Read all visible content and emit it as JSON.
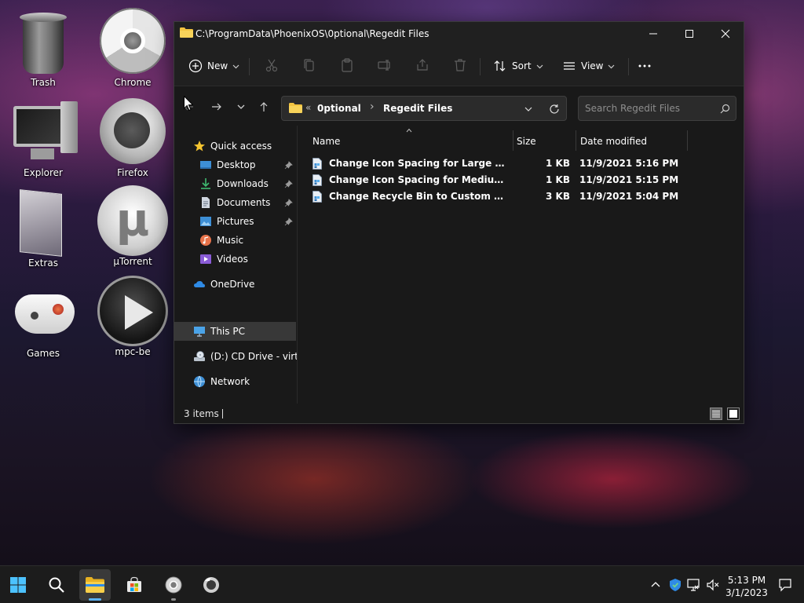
{
  "desktop": {
    "icons": [
      {
        "label": "Trash"
      },
      {
        "label": "Chrome"
      },
      {
        "label": "Explorer"
      },
      {
        "label": "Firefox"
      },
      {
        "label": "Extras"
      },
      {
        "label": "µTorrent"
      },
      {
        "label": "Games"
      },
      {
        "label": "mpc-be"
      }
    ]
  },
  "window": {
    "title": "C:\\ProgramData\\PhoenixOS\\0ptional\\Regedit Files",
    "commands": {
      "new_label": "New",
      "sort_label": "Sort",
      "view_label": "View"
    },
    "address": {
      "overflow": "«",
      "crumbs": [
        "0ptional",
        "Regedit Files"
      ],
      "separator": "›"
    },
    "search": {
      "placeholder": "Search Regedit Files"
    },
    "sidebar": {
      "items": [
        {
          "label": "Quick access",
          "icon": "star-icon"
        },
        {
          "label": "Desktop",
          "icon": "desktop-icon",
          "pinned": true
        },
        {
          "label": "Downloads",
          "icon": "download-icon",
          "pinned": true
        },
        {
          "label": "Documents",
          "icon": "document-icon",
          "pinned": true
        },
        {
          "label": "Pictures",
          "icon": "pictures-icon",
          "pinned": true
        },
        {
          "label": "Music",
          "icon": "music-icon"
        },
        {
          "label": "Videos",
          "icon": "videos-icon"
        },
        {
          "label": "OneDrive",
          "icon": "cloud-icon"
        },
        {
          "label": "This PC",
          "icon": "computer-icon",
          "selected": true
        },
        {
          "label": "(D:) CD Drive - virtio-win",
          "icon": "cd-drive-icon"
        },
        {
          "label": "Network",
          "icon": "network-icon"
        }
      ]
    },
    "columns": {
      "name": "Name",
      "size": "Size",
      "date": "Date modified"
    },
    "files": [
      {
        "name": "Change Icon Spacing for Large Desktop Icons.reg",
        "size": "1 KB",
        "date": "11/9/2021 5:16 PM"
      },
      {
        "name": "Change Icon Spacing for Medium Desktop Icons.reg",
        "size": "1 KB",
        "date": "11/9/2021 5:15 PM"
      },
      {
        "name": "Change Recycle Bin to Custom Icon.reg",
        "size": "3 KB",
        "date": "11/9/2021 5:04 PM"
      }
    ],
    "status": {
      "item_count": "3 items"
    }
  },
  "taskbar": {
    "clock_time": "5:13 PM",
    "clock_date": "3/1/2023"
  },
  "colors": {
    "accent": "#5db3f5",
    "folder": "#f3c441",
    "window_bg": "#191919",
    "chrome_bg": "#202020"
  }
}
